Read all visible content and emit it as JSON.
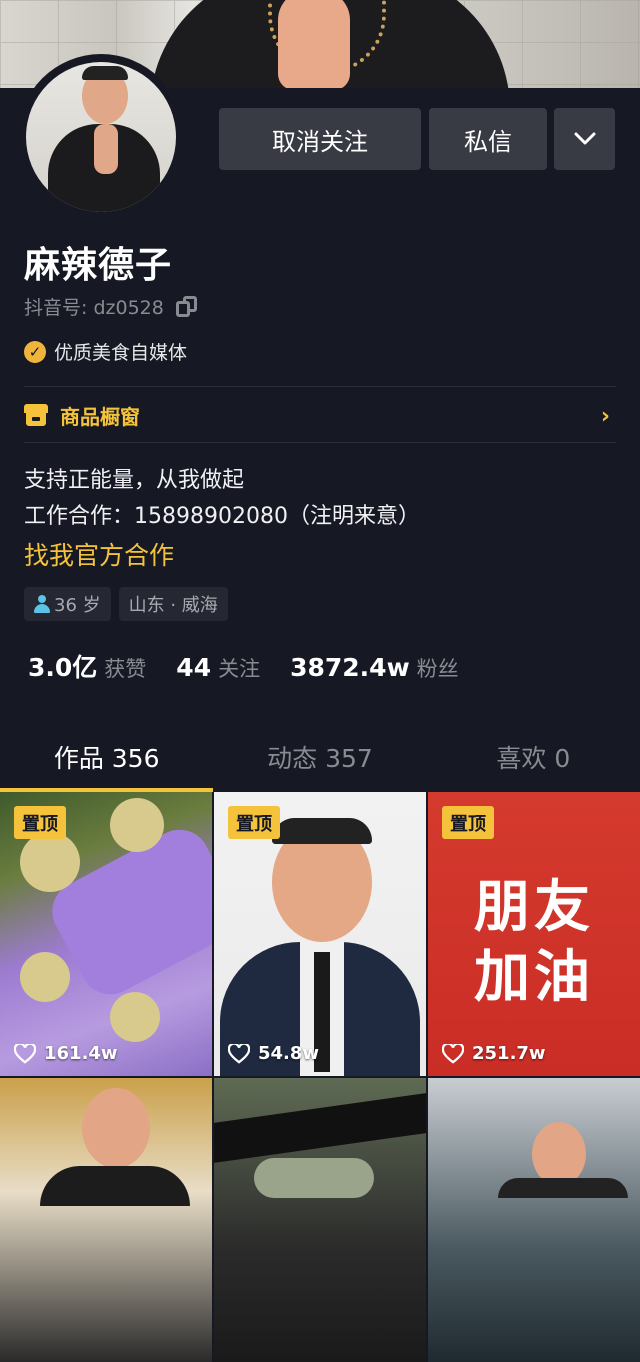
{
  "profile": {
    "nickname": "麻辣德子",
    "douyin_id": "抖音号: dz0528",
    "certification": "优质美食自媒体"
  },
  "actions": {
    "unfollow_label": "取消关注",
    "message_label": "私信",
    "more_label": "⌄"
  },
  "shop": {
    "label": "商品橱窗",
    "arrow": "›"
  },
  "bio": {
    "line1": "支持正能量，从我做起",
    "line2": "工作合作：15898902080（注明来意）",
    "link": "找我官方合作"
  },
  "tags": {
    "age": "36 岁",
    "location": "山东 · 威海"
  },
  "stats": [
    {
      "num": "3.0亿",
      "label": "获赞"
    },
    {
      "num": "44",
      "label": "关注"
    },
    {
      "num": "3872.4w",
      "label": "粉丝"
    }
  ],
  "tabs": [
    {
      "label": "作品 356",
      "active": true
    },
    {
      "label": "动态 357",
      "active": false
    },
    {
      "label": "喜欢 0",
      "active": false
    }
  ],
  "videos": [
    {
      "pinned": "置顶",
      "likes": "161.4w"
    },
    {
      "pinned": "置顶",
      "likes": "54.8w"
    },
    {
      "pinned": "置顶",
      "likes": "251.7w",
      "poster_line1": "朋友",
      "poster_line2": "加油"
    },
    {
      "likes": ""
    },
    {
      "likes": ""
    },
    {
      "likes": ""
    }
  ],
  "colors": {
    "background": "#161823",
    "accent": "#f5c33b",
    "button": "#393b44",
    "muted_text": "#8a8b91"
  },
  "icons": [
    "copy-icon",
    "verified-icon",
    "shop-icon",
    "chevron-right-icon",
    "chevron-down-icon",
    "person-icon",
    "heart-icon"
  ]
}
